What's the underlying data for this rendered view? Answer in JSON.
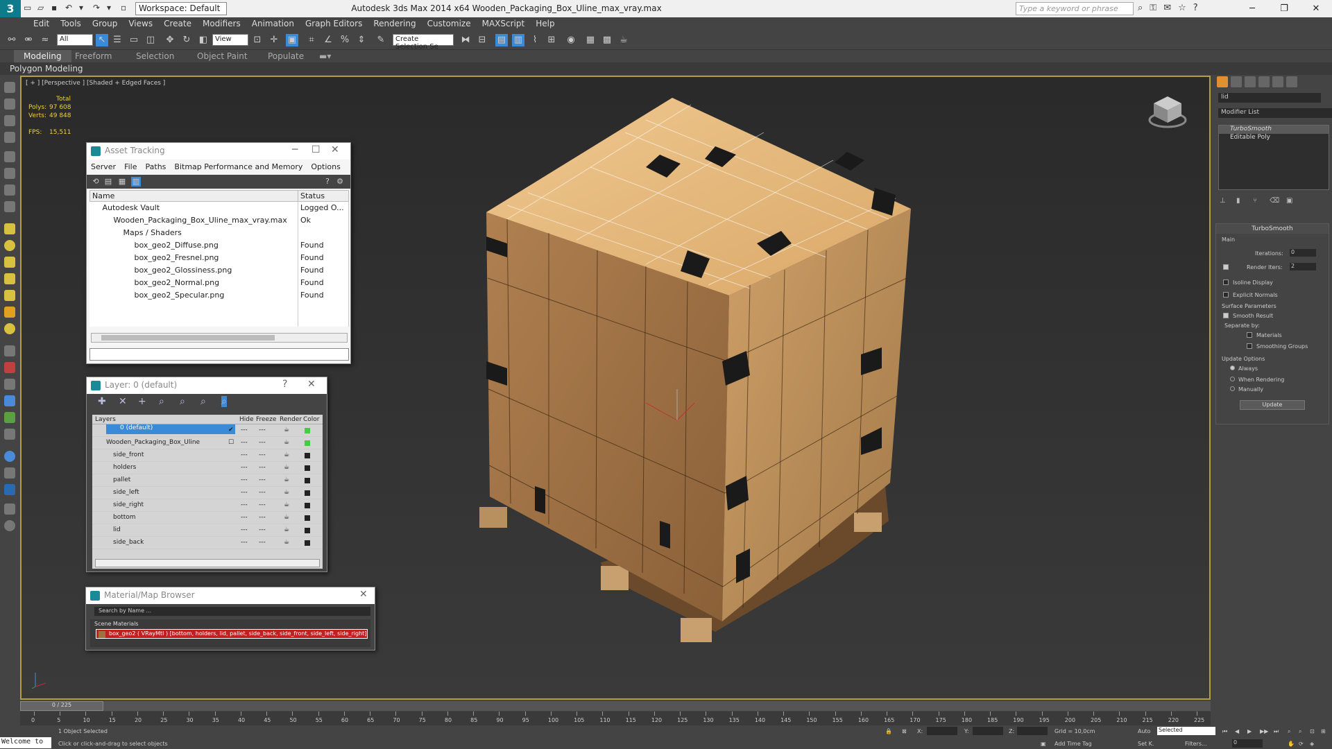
{
  "title_bar": {
    "workspace": "Workspace: Default",
    "app_title": "Autodesk 3ds Max  2014 x64    Wooden_Packaging_Box_Uline_max_vray.max",
    "search_placeholder": "Type a keyword or phrase"
  },
  "menu": [
    "Edit",
    "Tools",
    "Group",
    "Views",
    "Create",
    "Modifiers",
    "Animation",
    "Graph Editors",
    "Rendering",
    "Customize",
    "MAXScript",
    "Help"
  ],
  "toolbar": {
    "filter": "All",
    "refcoord": "View",
    "selection_set": "Create Selection Se"
  },
  "ribbon": {
    "tabs": [
      "Modeling",
      "Freeform",
      "Selection",
      "Object Paint",
      "Populate"
    ],
    "sub": "Polygon Modeling"
  },
  "viewport": {
    "label": "[ + ] [Perspective ] [Shaded + Edged Faces ]",
    "stats": {
      "total_label": "Total",
      "polys_label": "Polys:",
      "polys": "97 608",
      "verts_label": "Verts:",
      "verts": "49 848",
      "fps_label": "FPS:",
      "fps": "15,511"
    }
  },
  "asset_tracking": {
    "title": "Asset Tracking",
    "menu": [
      "Server",
      "File",
      "Paths",
      "Bitmap Performance and Memory",
      "Options"
    ],
    "col_name": "Name",
    "col_status": "Status",
    "rows": [
      {
        "name": "Autodesk Vault",
        "status": "Logged O..."
      },
      {
        "name": "Wooden_Packaging_Box_Uline_max_vray.max",
        "status": "Ok"
      },
      {
        "name": "Maps / Shaders",
        "status": ""
      },
      {
        "name": "box_geo2_Diffuse.png",
        "status": "Found"
      },
      {
        "name": "box_geo2_Fresnel.png",
        "status": "Found"
      },
      {
        "name": "box_geo2_Glossiness.png",
        "status": "Found"
      },
      {
        "name": "box_geo2_Normal.png",
        "status": "Found"
      },
      {
        "name": "box_geo2_Specular.png",
        "status": "Found"
      }
    ]
  },
  "layer": {
    "title": "Layer: 0 (default)",
    "headers": {
      "layers": "Layers",
      "hide": "Hide",
      "freeze": "Freeze",
      "render": "Render",
      "color": "Color"
    },
    "rows": [
      {
        "name": "0 (default)"
      },
      {
        "name": "Wooden_Packaging_Box_Uline"
      },
      {
        "name": "side_front"
      },
      {
        "name": "holders"
      },
      {
        "name": "pallet"
      },
      {
        "name": "side_left"
      },
      {
        "name": "side_right"
      },
      {
        "name": "bottom"
      },
      {
        "name": "lid"
      },
      {
        "name": "side_back"
      }
    ]
  },
  "material_browser": {
    "title": "Material/Map Browser",
    "search": "Search by Name ...",
    "section": "Scene Materials",
    "item": "box_geo2 ( VRayMtl ) [bottom, holders, lid, pallet, side_back, side_front, side_left, side_right]"
  },
  "command_panel": {
    "name": "lid",
    "modifier_list": "Modifier List",
    "stack": [
      "TurboSmooth",
      "Editable Poly"
    ],
    "rollout_title": "TurboSmooth",
    "main": "Main",
    "iterations_label": "Iterations:",
    "iterations": "0",
    "render_iters_label": "Render Iters:",
    "render_iters": "2",
    "isoline": "Isoline Display",
    "explicit": "Explicit Normals",
    "surface": "Surface Parameters",
    "smooth": "Smooth Result",
    "separate": "Separate by:",
    "materials": "Materials",
    "smoothing": "Smoothing Groups",
    "update_opts": "Update Options",
    "always": "Always",
    "when_rendering": "When Rendering",
    "manually": "Manually",
    "update": "Update"
  },
  "timeline": {
    "frame": "0 / 225",
    "ticks": [
      "0",
      "5",
      "10",
      "15",
      "20",
      "25",
      "30",
      "35",
      "40",
      "45",
      "50",
      "55",
      "60",
      "65",
      "70",
      "75",
      "80",
      "85",
      "90",
      "95",
      "100",
      "105",
      "110",
      "115",
      "120",
      "125",
      "130",
      "135",
      "140",
      "145",
      "150",
      "155",
      "160",
      "165",
      "170",
      "175",
      "180",
      "185",
      "190",
      "195",
      "200",
      "205",
      "210",
      "215",
      "220",
      "225"
    ]
  },
  "status": {
    "welcome": "Welcome to",
    "selected": "1 Object Selected",
    "hint": "Click or click-and-drag to select objects",
    "x_label": "X:",
    "y_label": "Y:",
    "z_label": "Z:",
    "grid": "Grid = 10,0cm",
    "add_time_tag": "Add Time Tag",
    "auto": "Auto",
    "selected_dd": "Selected",
    "set_key": "Set K.",
    "filters": "Filters...",
    "frame_field": "0"
  }
}
